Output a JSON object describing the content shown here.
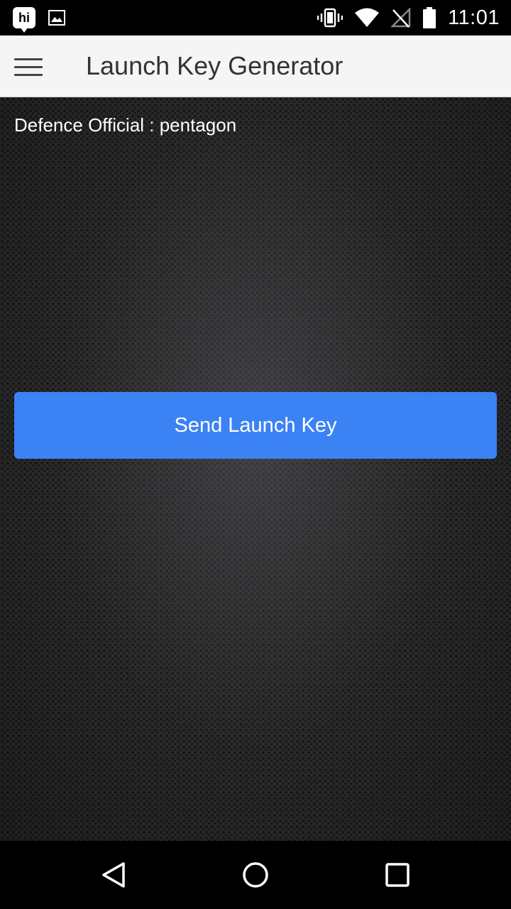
{
  "status_bar": {
    "left_icons": [
      "hi-app-icon",
      "image-icon"
    ],
    "hi_label": "hi",
    "right_icons": [
      "vibrate-icon",
      "wifi-icon",
      "no-signal-icon",
      "battery-icon"
    ],
    "time": "11:01"
  },
  "app_bar": {
    "menu_icon": "hamburger-menu-icon",
    "title": "Launch Key Generator",
    "background": "#f5f5f5"
  },
  "main": {
    "official_text": "Defence Official : pentagon",
    "send_button_label": "Send Launch Key",
    "button_color": "#3b82f4"
  },
  "nav_bar": {
    "buttons": [
      "back-icon",
      "home-icon",
      "recents-icon"
    ]
  }
}
